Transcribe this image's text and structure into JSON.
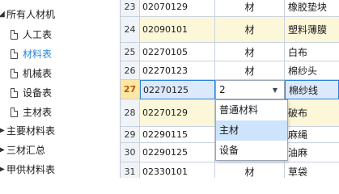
{
  "tree": {
    "items": [
      {
        "label": "所有人材机",
        "arrow": "◢"
      },
      {
        "label": "人工表"
      },
      {
        "label": "材料表"
      },
      {
        "label": "机械表"
      },
      {
        "label": "设备表"
      },
      {
        "label": "主材表"
      },
      {
        "label": "主要材料表",
        "arrow": "▶"
      },
      {
        "label": "三材汇总",
        "arrow": "▶"
      },
      {
        "label": "甲供材料表",
        "arrow": "▶"
      }
    ],
    "selected": "材料表"
  },
  "grid": {
    "rows": [
      {
        "num": "23",
        "code": "02070129",
        "type": "材",
        "name": "橡胶垫块"
      },
      {
        "num": "24",
        "code": "02090101",
        "type": "材",
        "name": "塑料薄膜"
      },
      {
        "num": "25",
        "code": "02270105",
        "type": "材",
        "name": "白布"
      },
      {
        "num": "26",
        "code": "02270123",
        "type": "材",
        "name": "棉纱头"
      },
      {
        "num": "27",
        "code": "02270125",
        "type": "2",
        "name": "棉纱线"
      },
      {
        "num": "28",
        "code": "02270129",
        "type": "",
        "name": "破布"
      },
      {
        "num": "29",
        "code": "02290115",
        "type": "",
        "name": "麻绳"
      },
      {
        "num": "30",
        "code": "02290125",
        "type": "",
        "name": "油麻"
      },
      {
        "num": "31",
        "code": "02330101",
        "type": "材",
        "name": "草袋"
      }
    ]
  },
  "dropdown": {
    "options": [
      "普通材料",
      "主材",
      "设备"
    ],
    "highlighted": "主材"
  }
}
